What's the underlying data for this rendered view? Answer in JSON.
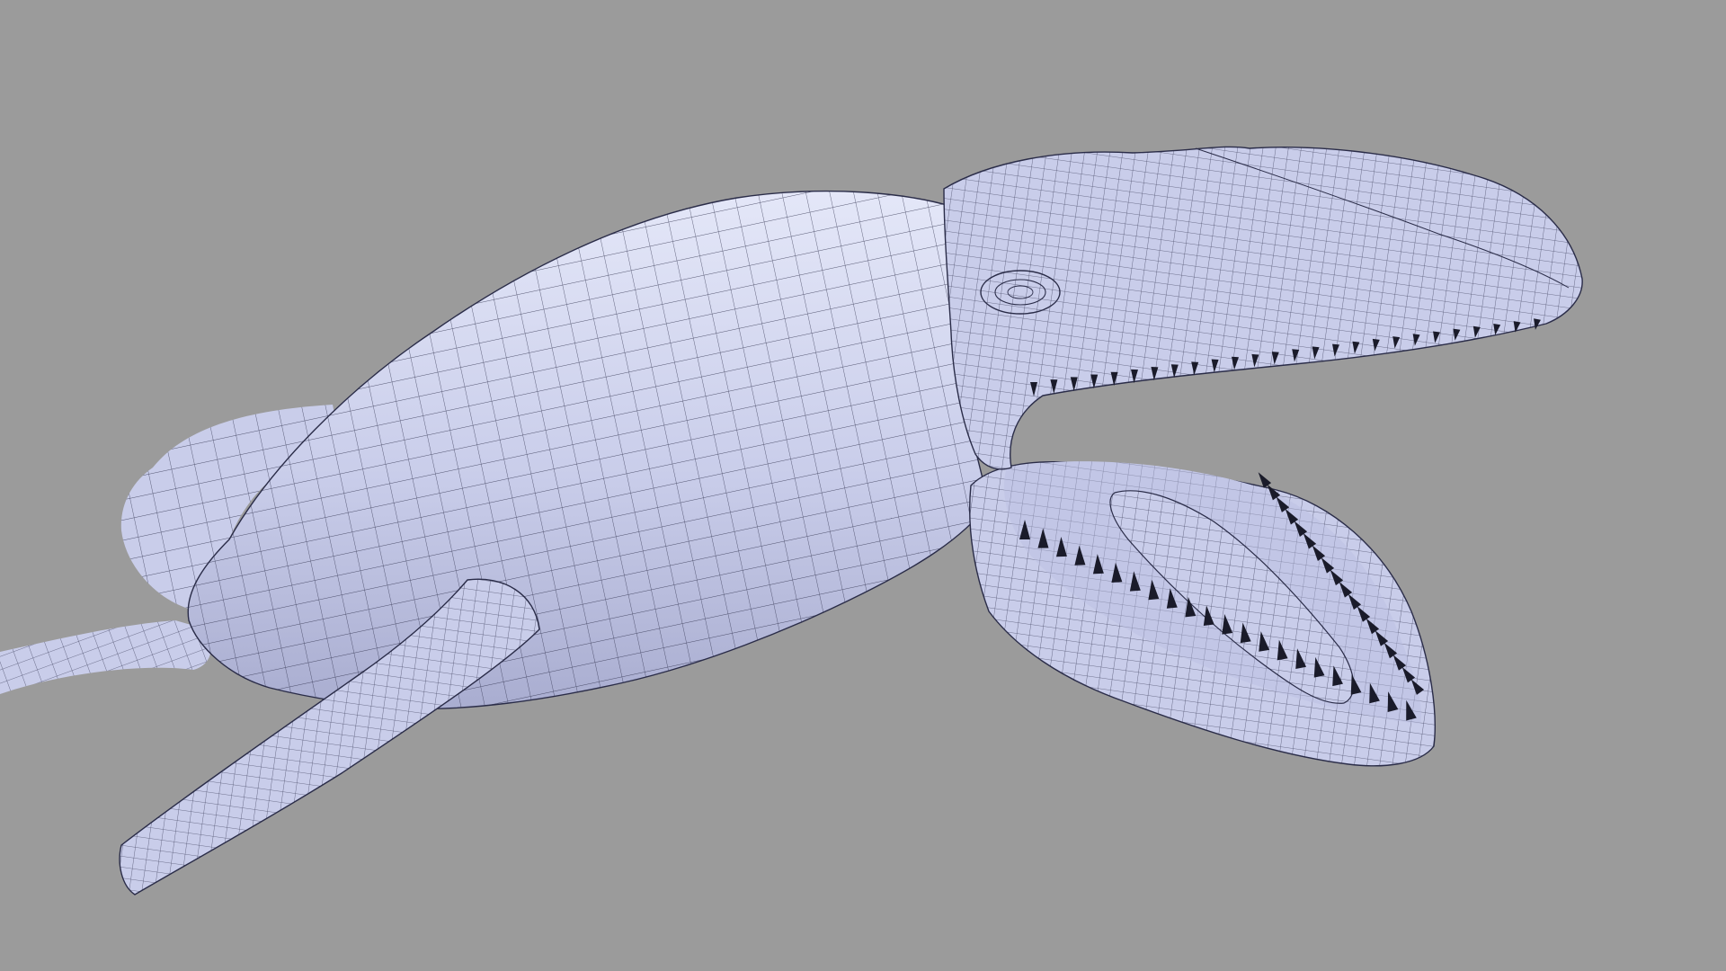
{
  "viewport": {
    "background_color": "#9b9b9b",
    "subject": "wireframe-whale-model",
    "visible_text": []
  },
  "model": {
    "surface_color": "#c9cdea",
    "surface_shadow_color": "#a9add0",
    "surface_highlight_color": "#e4e7f8",
    "wire_color": "#2a2c48",
    "teeth_color": "#1a1b2a",
    "mouth_interior_color": "#c2c6e6",
    "mouth_open": true,
    "parts": [
      "tail",
      "tail-fluke",
      "body",
      "pectoral-fin",
      "head",
      "eye",
      "upper-jaw",
      "lower-jaw",
      "tongue",
      "teeth"
    ]
  }
}
